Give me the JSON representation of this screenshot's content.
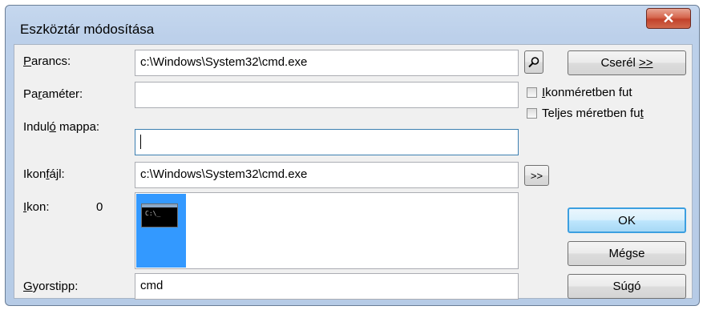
{
  "window": {
    "title": "Eszköztár módosítása",
    "close_glyph": "✕"
  },
  "labels": {
    "parancs_u": "P",
    "parancs_rest": "arancs:",
    "parameter_pre": "Pa",
    "parameter_u": "r",
    "parameter_rest": "améter:",
    "indulo_pre": "Indul",
    "indulo_u": "ó",
    "indulo_rest": " mappa:",
    "ikonfajl_pre": "Ikon",
    "ikonfajl_u": "f",
    "ikonfajl_rest": "ájl:",
    "ikon_u": "I",
    "ikon_rest": "kon:",
    "ikon_index": "0",
    "gyorstipp_u": "G",
    "gyorstipp_rest": "yorstipp:"
  },
  "fields": {
    "parancs": "c:\\Windows\\System32\\cmd.exe",
    "parameter": "",
    "indulo_mappa": "",
    "ikonfajl": "c:\\Windows\\System32\\cmd.exe",
    "gyorstipp": "cmd"
  },
  "buttons": {
    "browse_icon": "search-icon",
    "csere_pre": "Cserél ",
    "csere_u": ">>",
    "ikonfajl_browse": ">>",
    "ok": "OK",
    "megse": "Mégse",
    "sugo": "Súgó"
  },
  "checkboxes": {
    "ikonmeret_u": "I",
    "ikonmeret_rest": "konméretben fut",
    "teljes_pre": "Teljes méretben fu",
    "teljes_u": "t",
    "ikonmeret_checked": false,
    "teljes_checked": false
  },
  "icon_list": {
    "selected_icon": "cmd-icon",
    "icon_text": "C:\\_"
  }
}
